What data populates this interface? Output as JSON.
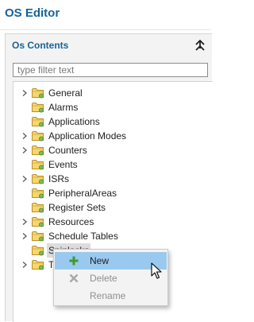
{
  "editor": {
    "title": "OS Editor"
  },
  "panel": {
    "title": "Os Contents",
    "collapse_icon": "collapse-all-icon",
    "filter": {
      "placeholder": "type filter text",
      "value": ""
    }
  },
  "tree": {
    "folder_icon": "folder-icon",
    "expand_icon": "chevron-right-icon",
    "items": [
      {
        "label": "General",
        "expandable": true,
        "selected": false
      },
      {
        "label": "Alarms",
        "expandable": false,
        "selected": false
      },
      {
        "label": "Applications",
        "expandable": false,
        "selected": false
      },
      {
        "label": "Application Modes",
        "expandable": true,
        "selected": false
      },
      {
        "label": "Counters",
        "expandable": true,
        "selected": false
      },
      {
        "label": "Events",
        "expandable": false,
        "selected": false
      },
      {
        "label": "ISRs",
        "expandable": true,
        "selected": false
      },
      {
        "label": "PeripheralAreas",
        "expandable": false,
        "selected": false
      },
      {
        "label": "Register Sets",
        "expandable": false,
        "selected": false
      },
      {
        "label": "Resources",
        "expandable": true,
        "selected": false
      },
      {
        "label": "Schedule Tables",
        "expandable": true,
        "selected": false
      },
      {
        "label": "Spinlocks",
        "expandable": false,
        "selected": true
      },
      {
        "label": "Task",
        "expandable": true,
        "selected": false
      }
    ]
  },
  "context_menu": {
    "items": [
      {
        "label": "New",
        "icon": "plus-icon",
        "enabled": true,
        "hovered": true
      },
      {
        "label": "Delete",
        "icon": "delete-x-icon",
        "enabled": false,
        "hovered": false
      },
      {
        "label": "Rename",
        "icon": "",
        "enabled": false,
        "hovered": false
      }
    ]
  },
  "colors": {
    "title_blue": "#17639a",
    "folder_yellow": "#f2c94c",
    "menu_hover": "#99c9ef"
  }
}
